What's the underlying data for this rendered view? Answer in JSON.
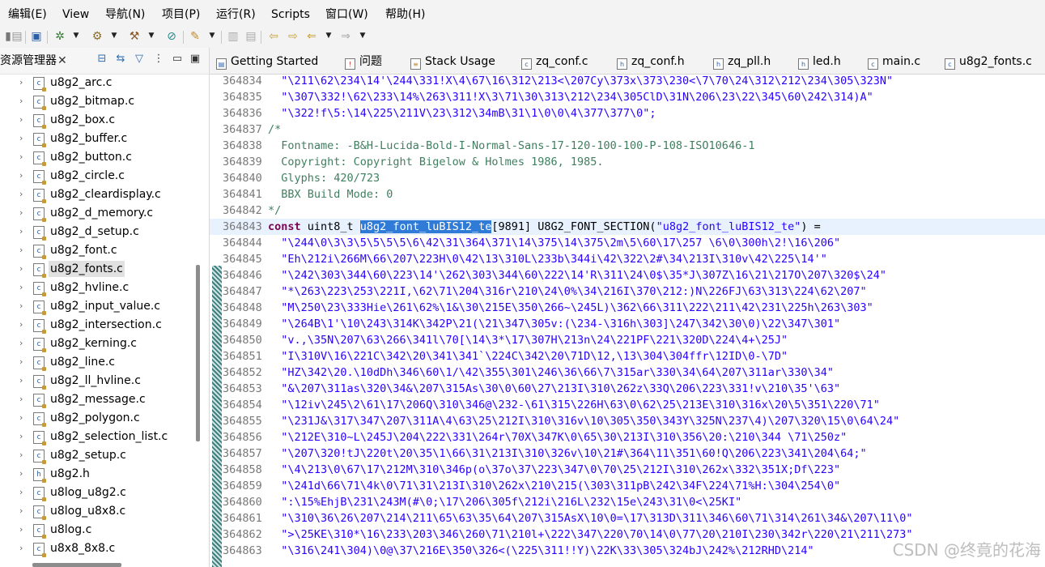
{
  "menubar": {
    "items": [
      "编辑(E)",
      "View",
      "导航(N)",
      "项目(P)",
      "运行(R)",
      "Scripts",
      "窗口(W)",
      "帮助(H)"
    ]
  },
  "explorer": {
    "title": "资源管理器",
    "close": "✕",
    "files": [
      "u8g2_arc.c",
      "u8g2_bitmap.c",
      "u8g2_box.c",
      "u8g2_buffer.c",
      "u8g2_button.c",
      "u8g2_circle.c",
      "u8g2_cleardisplay.c",
      "u8g2_d_memory.c",
      "u8g2_d_setup.c",
      "u8g2_font.c",
      "u8g2_fonts.c",
      "u8g2_hvline.c",
      "u8g2_input_value.c",
      "u8g2_intersection.c",
      "u8g2_kerning.c",
      "u8g2_line.c",
      "u8g2_ll_hvline.c",
      "u8g2_message.c",
      "u8g2_polygon.c",
      "u8g2_selection_list.c",
      "u8g2_setup.c",
      "u8g2.h",
      "u8log_u8g2.c",
      "u8log_u8x8.c",
      "u8log.c",
      "u8x8_8x8.c"
    ],
    "selected_index": 10
  },
  "tabs": [
    "Getting Started",
    "问题",
    "Stack Usage",
    "zq_conf.c",
    "zq_conf.h",
    "zq_pll.h",
    "led.h",
    "main.c",
    "u8g2_fonts.c"
  ],
  "active_tab": "u8g2_fonts.c",
  "code": {
    "lines": [
      {
        "n": "364834",
        "t": "  \"\\211\\62\\234\\14'\\244\\331!X\\4\\67\\16\\312\\213<\\207Cy\\373x\\373\\230<\\7\\70\\24\\312\\212\\234\\305\\323N\"",
        "k": "str"
      },
      {
        "n": "364835",
        "t": "  \"\\307\\332!\\62\\233\\14%\\263\\311!X\\3\\71\\30\\313\\212\\234\\305ClD\\31N\\206\\23\\22\\345\\60\\242\\314)A\"",
        "k": "str"
      },
      {
        "n": "364836",
        "t": "  \"\\322!f\\5:\\14\\225\\211V\\23\\312\\34mB\\31\\1\\0\\0\\4\\377\\377\\0\";",
        "k": "str"
      },
      {
        "n": "364837",
        "t": "/*",
        "k": "cmt"
      },
      {
        "n": "364838",
        "t": "  Fontname: -B&H-Lucida-Bold-I-Normal-Sans-17-120-100-100-P-108-ISO10646-1",
        "k": "cmt"
      },
      {
        "n": "364839",
        "t": "  Copyright: Copyright Bigelow & Holmes 1986, 1985.",
        "k": "cmt"
      },
      {
        "n": "364840",
        "t": "  Glyphs: 420/723",
        "k": "cmt"
      },
      {
        "n": "364841",
        "t": "  BBX Build Mode: 0",
        "k": "cmt"
      },
      {
        "n": "364842",
        "t": "*/",
        "k": "cmt"
      },
      {
        "n": "364843",
        "k": "decl",
        "kw1": "const",
        "mid1": " uint8_t ",
        "sel": "u8g2_font_luBIS12_te",
        "mid2": "[9891] U8G2_FONT_SECTION(",
        "str": "\"u8g2_font_luBIS12_te\"",
        "end": ") ="
      },
      {
        "n": "364844",
        "t": "  \"\\244\\0\\3\\3\\5\\5\\5\\5\\6\\42\\31\\364\\371\\14\\375\\14\\375\\2m\\5\\60\\17\\257 \\6\\0\\300h\\2!\\16\\206\"",
        "k": "str"
      },
      {
        "n": "364845",
        "t": "  \"Eh\\212i\\266M\\66\\207\\223H\\0\\42\\13\\310L\\233b\\344i\\42\\322\\2#\\34\\213I\\310v\\42\\225\\14'\"",
        "k": "str"
      },
      {
        "n": "364846",
        "t": "  \"\\242\\303\\344\\60\\223\\14'\\262\\303\\344\\60\\222\\14'R\\311\\24\\0$\\35*J\\307Z\\16\\21\\217O\\207\\320$\\24\"",
        "k": "str"
      },
      {
        "n": "364847",
        "t": "  \"*\\263\\223\\253\\221I,\\62\\71\\204\\316r\\210\\24\\0%\\34\\216I\\370\\212:)N\\226FJ\\63\\313\\224\\62\\207\"",
        "k": "str"
      },
      {
        "n": "364848",
        "t": "  \"M\\250\\23\\333Hie\\261\\62%\\1&\\30\\215E\\350\\266~\\245L)\\362\\66\\311\\222\\211\\42\\231\\225h\\263\\303\"",
        "k": "str"
      },
      {
        "n": "364849",
        "t": "  \"\\264B\\1'\\10\\243\\314K\\342P\\21(\\21\\347\\305v:(\\234-\\316h\\303]\\247\\342\\30\\0)\\22\\347\\301\"",
        "k": "str"
      },
      {
        "n": "364850",
        "t": "  \"v.,\\35N\\207\\63\\266\\341l\\70[\\14\\3*\\17\\307H\\213n\\24\\221PF\\221\\320D\\224\\4+\\25J\"",
        "k": "str"
      },
      {
        "n": "364851",
        "t": "  \"I\\310V\\16\\221C\\342\\20\\341\\341`\\224C\\342\\20\\71D\\12,\\13\\304\\304ffr\\12ID\\0-\\7D\"",
        "k": "str"
      },
      {
        "n": "364852",
        "t": "  \"HZ\\342\\20.\\10dDh\\346\\60\\1/\\42\\355\\301\\246\\36\\66\\7\\315ar\\330\\34\\64\\207\\311ar\\330\\34\"",
        "k": "str"
      },
      {
        "n": "364853",
        "t": "  \"&\\207\\311as\\320\\34&\\207\\315As\\30\\0\\60\\27\\213I\\310\\262z\\33Q\\206\\223\\331!v\\210\\35'\\63\"",
        "k": "str"
      },
      {
        "n": "364854",
        "t": "  \"\\12iv\\245\\2\\61\\17\\206Q\\310\\346@\\232-\\61\\315\\226H\\63\\0\\62\\25\\213E\\310\\316x\\20\\5\\351\\220\\71\"",
        "k": "str"
      },
      {
        "n": "364855",
        "t": "  \"\\231J&\\317\\347\\207\\311A\\4\\63\\25\\212I\\310\\316v\\10\\305\\350\\343Y\\325N\\237\\4)\\207\\320\\15\\0\\64\\24\"",
        "k": "str"
      },
      {
        "n": "364856",
        "t": "  \"\\212E\\310~L\\245J\\204\\222\\331\\264r\\70X\\347K\\0\\65\\30\\213I\\310\\356\\20:\\210\\344 \\71\\250z\"",
        "k": "str"
      },
      {
        "n": "364857",
        "t": "  \"\\207\\320!tJ\\220t\\20\\35\\1\\66\\31\\213I\\310\\326v\\10\\21#\\364\\11\\351\\60!Q\\206\\223\\341\\204\\64;\"",
        "k": "str"
      },
      {
        "n": "364858",
        "t": "  \"\\4\\213\\0\\67\\17\\212M\\310\\346p(o\\37o\\37\\223\\347\\0\\70\\25\\212I\\310\\262x\\332\\351X;Df\\223\"",
        "k": "str"
      },
      {
        "n": "364859",
        "t": "  \"\\241d\\66\\71\\4k\\0\\71\\31\\213I\\310\\262x\\210\\215(\\303\\311pB\\242\\34F\\224\\71%H:\\304\\254\\0\"",
        "k": "str"
      },
      {
        "n": "364860",
        "t": "  \":\\15%EhjB\\231\\243M(#\\0;\\17\\206\\305f\\212i\\216L\\232\\15e\\243\\31\\0<\\25KI\"",
        "k": "str"
      },
      {
        "n": "364861",
        "t": "  \"\\310\\36\\26\\207\\214\\211\\65\\63\\35\\64\\207\\315AsX\\10\\0=\\17\\313D\\311\\346\\60\\71\\314\\261\\34&\\207\\11\\0\"",
        "k": "str"
      },
      {
        "n": "364862",
        "t": "  \">\\25KE\\310*\\16\\233\\203\\346\\260\\71\\210l+\\222\\347\\220\\70\\14\\0\\77\\20\\210I\\230\\342r\\220\\21\\211\\273\"",
        "k": "str"
      },
      {
        "n": "364863",
        "t": "  \"\\316\\241\\304)\\0@\\37\\216E\\350\\326<(\\225\\311!!Y)\\22K\\33\\305\\324bJ\\242%\\212RHD\\214\"",
        "k": "str"
      }
    ],
    "current_line_index": 9
  },
  "watermark": "CSDN @终竟的花海"
}
